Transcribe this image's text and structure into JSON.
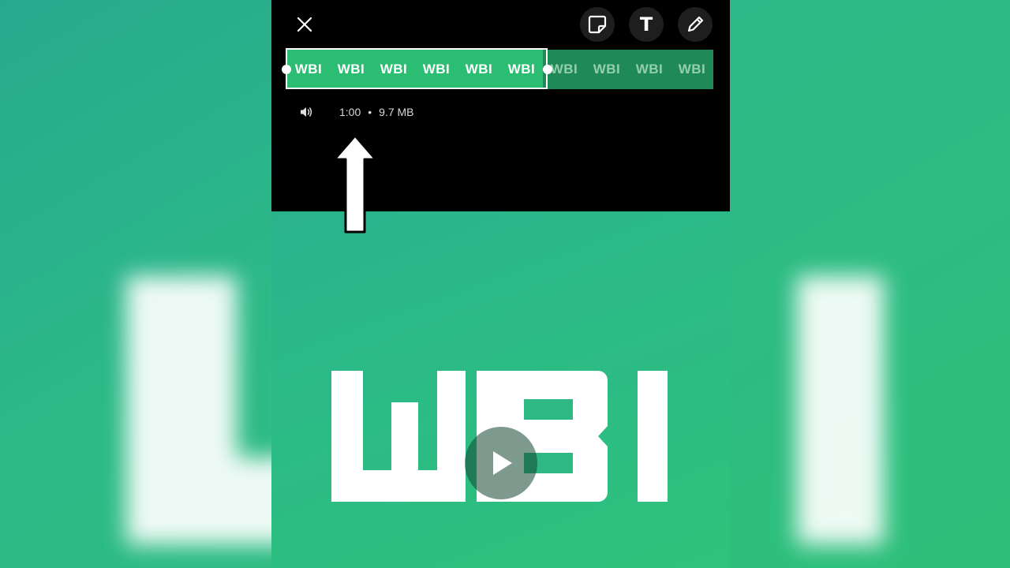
{
  "toolbar": {
    "close_icon": "close-icon",
    "sticker_icon": "sticker-icon",
    "text_label": "T",
    "pencil_icon": "pencil-icon"
  },
  "timeline": {
    "frames": [
      "WBI",
      "WBI",
      "WBI",
      "WBI",
      "WBI",
      "WBI",
      "WBI",
      "WBI",
      "WBI",
      "WBI"
    ],
    "selected_frames": 6
  },
  "info": {
    "duration": "1:00",
    "separator": "•",
    "size": "9.7 MB"
  },
  "video": {
    "logo_text": "WBI",
    "play_icon": "play-icon"
  },
  "colors": {
    "accent": "#2bbd72",
    "editor_bg": "#000000",
    "background": "#2cb987"
  }
}
